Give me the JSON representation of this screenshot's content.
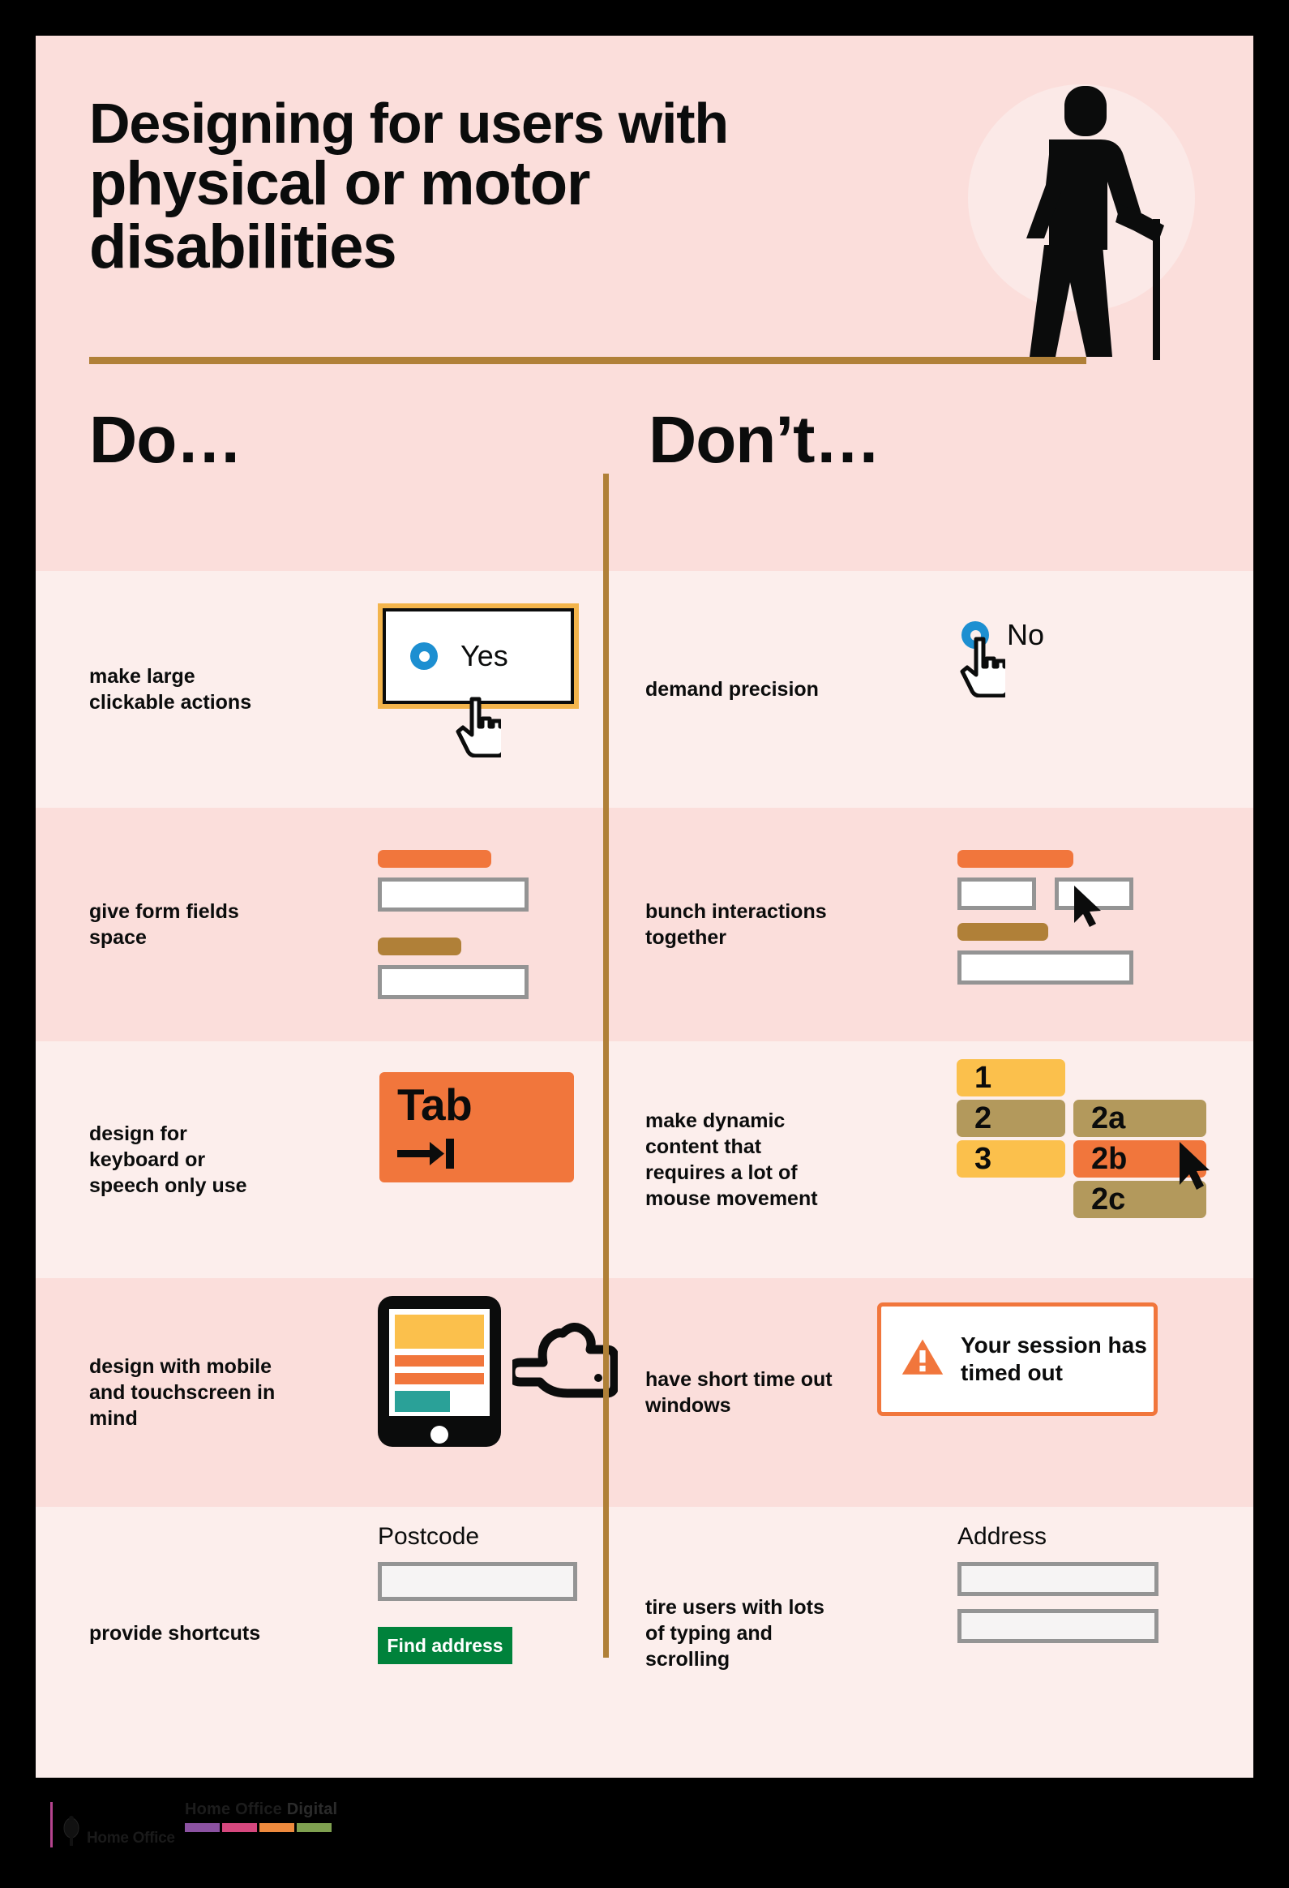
{
  "poster": {
    "title_lines": [
      "Designing for users with",
      "physical or motor",
      "disabilities"
    ],
    "hero_icon": "person-with-cane-icon",
    "do_heading": "Do…",
    "dont_heading": "Don’t…",
    "colors": {
      "background_light": "#FCEEEC",
      "background_dark": "#FBDEDB",
      "rule": "#B08038",
      "orange": "#F1763C",
      "gold": "#B08038",
      "yellow": "#FBC04C",
      "tan": "#B3995C",
      "teal": "#2AA198",
      "green": "#00823B",
      "blue": "#1D8FD1",
      "grey_border": "#949494"
    }
  },
  "rows": [
    {
      "do": {
        "caption": "make large clickable actions",
        "radio_label": "Yes",
        "radio_state": "selected",
        "cursor": "hand-pointer-cursor"
      },
      "dont": {
        "caption": "demand precision",
        "radio_label": "No",
        "radio_state": "unselected",
        "cursor": "hand-pointer-cursor"
      }
    },
    {
      "do": {
        "caption": "give form fields space",
        "fields": [
          "orange-label-bar",
          "text-input",
          "gold-label-bar",
          "text-input"
        ]
      },
      "dont": {
        "caption": "bunch interactions together",
        "fields": [
          "orange-label-bar",
          "text-input",
          "text-input",
          "gold-label-bar",
          "text-input"
        ],
        "cursor": "arrow-cursor"
      }
    },
    {
      "do": {
        "caption": "design for keyboard or speech only use",
        "key_label": "Tab",
        "key_glyph": "tab-arrow-icon"
      },
      "dont": {
        "caption": "make dynamic content that requires a lot of mouse movement",
        "blocks": [
          {
            "label": "1",
            "color": "#FBC04C"
          },
          {
            "label": "2",
            "color": "#B3995C"
          },
          {
            "label": "3",
            "color": "#FBC04C"
          },
          {
            "label": "2a",
            "color": "#B3995C"
          },
          {
            "label": "2b",
            "color": "#F1763C"
          },
          {
            "label": "2c",
            "color": "#B3995C"
          }
        ],
        "cursor": "arrow-cursor"
      }
    },
    {
      "do": {
        "caption": "design with mobile and touchscreen in mind",
        "device": "tablet-icon",
        "gesture": "pointing-hand-icon"
      },
      "dont": {
        "caption": "have short time out windows",
        "alert_icon": "warning-triangle-icon",
        "alert_text": "Your session has timed out"
      }
    },
    {
      "do": {
        "caption": "provide shortcuts",
        "field_label": "Postcode",
        "field_value": "",
        "button_label": "Find address"
      },
      "dont": {
        "caption": "tire users with lots of typing and scrolling",
        "field_label": "Address",
        "field_values": [
          "",
          ""
        ]
      }
    }
  ],
  "footer": {
    "home_office": "Home Office",
    "home_office_digital_1": "Home Office ",
    "home_office_digital_2": "Digital",
    "bar_colors": [
      "#8B52A1",
      "#D6487E",
      "#ED8A3E",
      "#7FA martins"
    ]
  }
}
